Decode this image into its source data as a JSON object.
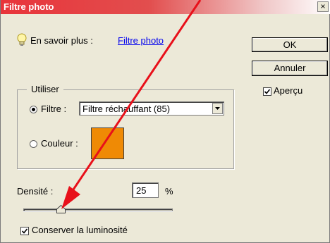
{
  "window": {
    "title": "Filtre photo",
    "close_glyph": "×"
  },
  "hint": {
    "icon": "lightbulb-icon",
    "label": "En savoir plus :",
    "link": "Filtre photo"
  },
  "buttons": {
    "ok": "OK",
    "cancel": "Annuler"
  },
  "preview": {
    "label": "Aperçu",
    "checked": true
  },
  "use_group": {
    "legend": "Utiliser",
    "filter": {
      "label": "Filtre :",
      "selected": true,
      "value": "Filtre réchauffant (85)"
    },
    "color": {
      "label": "Couleur :",
      "selected": false,
      "swatch": "#ef8a05"
    }
  },
  "density": {
    "label": "Densité :",
    "value": "25",
    "unit": "%",
    "slider_fraction": 0.25
  },
  "preserve_luminosity": {
    "label": "Conserver la luminosité",
    "checked": true
  },
  "annotation": {
    "arrow_color": "#e8101a"
  }
}
